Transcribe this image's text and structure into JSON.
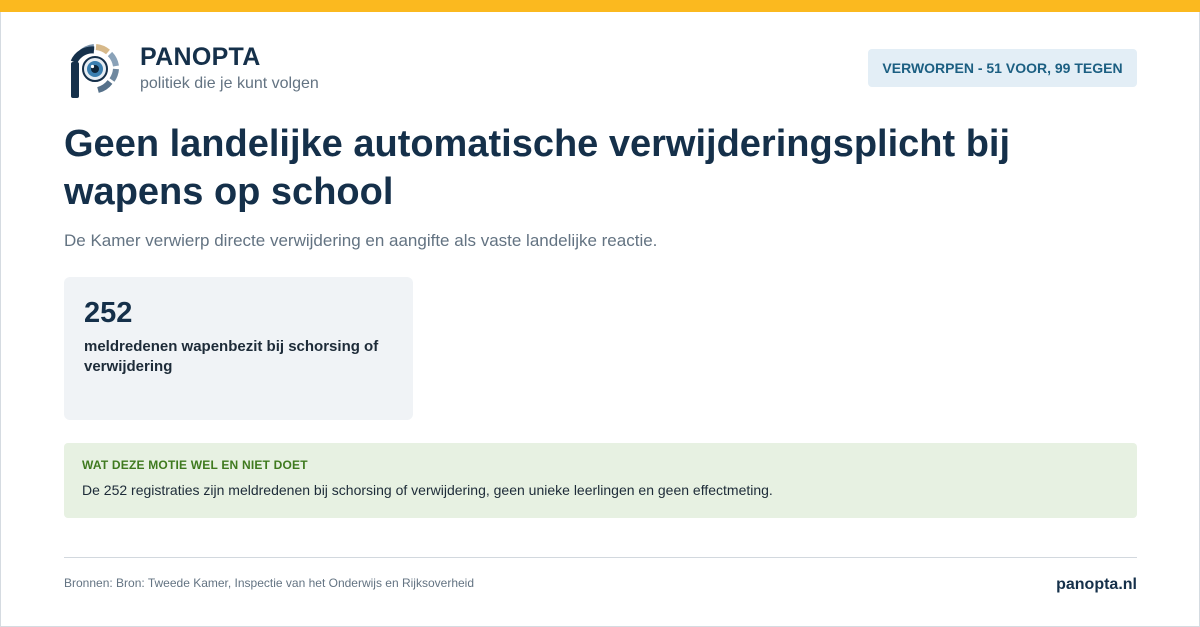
{
  "brand": {
    "name": "PANOPTA",
    "tagline": "politiek die je kunt volgen",
    "logo_icon": "eye-p-logo-icon"
  },
  "status_badge": "VERWORPEN - 51 VOOR, 99 TEGEN",
  "headline": "Geen landelijke automatische verwijderingsplicht bij wapens op school",
  "subheadline": "De Kamer verwierp directe verwijdering en aangifte als vaste landelijke reactie.",
  "stat": {
    "value": "252",
    "label": "meldredenen wapenbezit bij schorsing of verwijdering"
  },
  "note": {
    "heading": "WAT DEZE MOTIE WEL EN NIET DOET",
    "text": "De 252 registraties zijn meldredenen bij schorsing of verwijdering, geen unieke leerlingen en geen effectmeting."
  },
  "footer": {
    "sources": "Bronnen: Bron: Tweede Kamer, Inspectie van het Onderwijs en Rijksoverheid",
    "site": "panopta.nl"
  },
  "colors": {
    "accent_bar": "#fbb91f",
    "primary_text": "#15304a",
    "badge_bg": "#e3eef6",
    "note_bg": "#e7f1e2",
    "note_heading": "#3f7a1f"
  }
}
